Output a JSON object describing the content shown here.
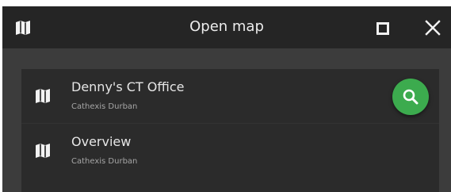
{
  "window": {
    "title": "Open map",
    "title_icon": "map-icon",
    "maximize_icon": "maximize-icon",
    "close_icon": "close-icon"
  },
  "maps": [
    {
      "name": "Denny's CT Office",
      "subtitle": "Cathexis Durban",
      "icon": "map-icon"
    },
    {
      "name": "Overview",
      "subtitle": "Cathexis Durban",
      "icon": "map-icon"
    }
  ],
  "search_button": {
    "icon": "search-icon",
    "color": "#3cab4e"
  },
  "colors": {
    "titlebar": "#252525",
    "window_background": "#3c3c3c",
    "list_background": "#2b2b2b",
    "accent": "#3cab4e"
  }
}
